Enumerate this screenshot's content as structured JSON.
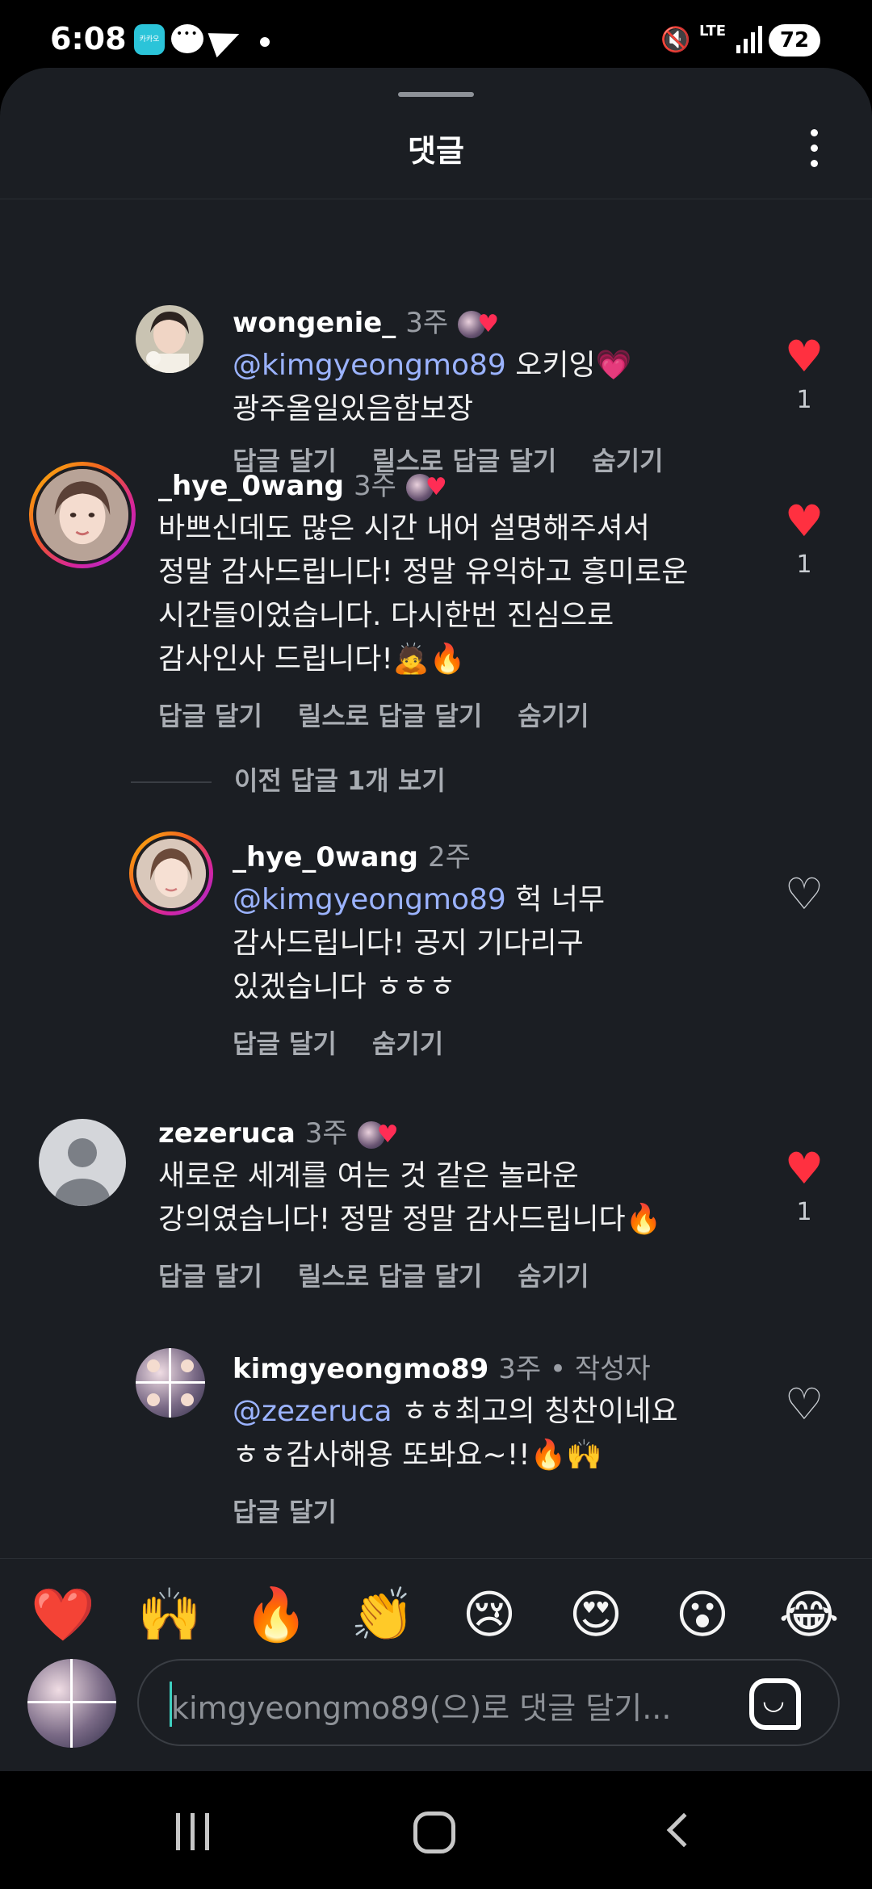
{
  "status_bar": {
    "time": "6:08",
    "app_badge": "카카오",
    "lte": "LTE",
    "battery": "72"
  },
  "sheet": {
    "title": "댓글"
  },
  "actions": {
    "reply": "답글 달기",
    "reels_reply": "릴스로 답글 달기",
    "hide": "숨기기"
  },
  "comments": [
    {
      "username": "wongenie_",
      "time": "3주",
      "mention": "@kimgyeongmo89",
      "text_inline": " 오키잉💗",
      "text_rest": "광주올일있음함보장",
      "likes": "1"
    },
    {
      "username": "_hye_0wang",
      "time": "3주",
      "text_lines": [
        "바쁘신데도 많은 시간 내어 설명해주셔서",
        "정말 감사드립니다! 정말 유익하고 흥미로운",
        "시간들이었습니다. 다시한번 진심으로",
        "감사인사 드립니다!🙇🔥"
      ],
      "likes": "1"
    },
    {
      "username": "_hye_0wang",
      "time": "2주",
      "mention": "@kimgyeongmo89",
      "text_inline": " 헉 너무",
      "text_lines": [
        "감사드립니다! 공지 기다리구",
        "있겠습니다 ㅎㅎㅎ"
      ]
    },
    {
      "username": "zezeruca",
      "time": "3주",
      "text_lines": [
        "새로운 세계를 여는 것 같은 놀라운",
        "강의였습니다! 정말 정말 감사드립니다🔥"
      ],
      "likes": "1"
    },
    {
      "username": "kimgyeongmo89",
      "time": "3주",
      "author_label": " • 작성자",
      "mention": "@zezeruca",
      "text_inline": " ㅎㅎ최고의 칭찬이네요",
      "text_lines": [
        "ㅎㅎ감사해용 또봐요~!!🔥🙌"
      ]
    }
  ],
  "view_previous": "이전 답글 1개 보기",
  "emoji_bar": [
    "❤️",
    "🙌",
    "🔥",
    "👏",
    "😢",
    "😍",
    "😮",
    "😂"
  ],
  "input": {
    "placeholder": "kimgyeongmo89(으)로 댓글 달기..."
  },
  "colors": {
    "background": "#1b1e23",
    "mention": "#9bb3ff",
    "like_heart": "#ff3040",
    "muted_text": "#a8acb2"
  }
}
